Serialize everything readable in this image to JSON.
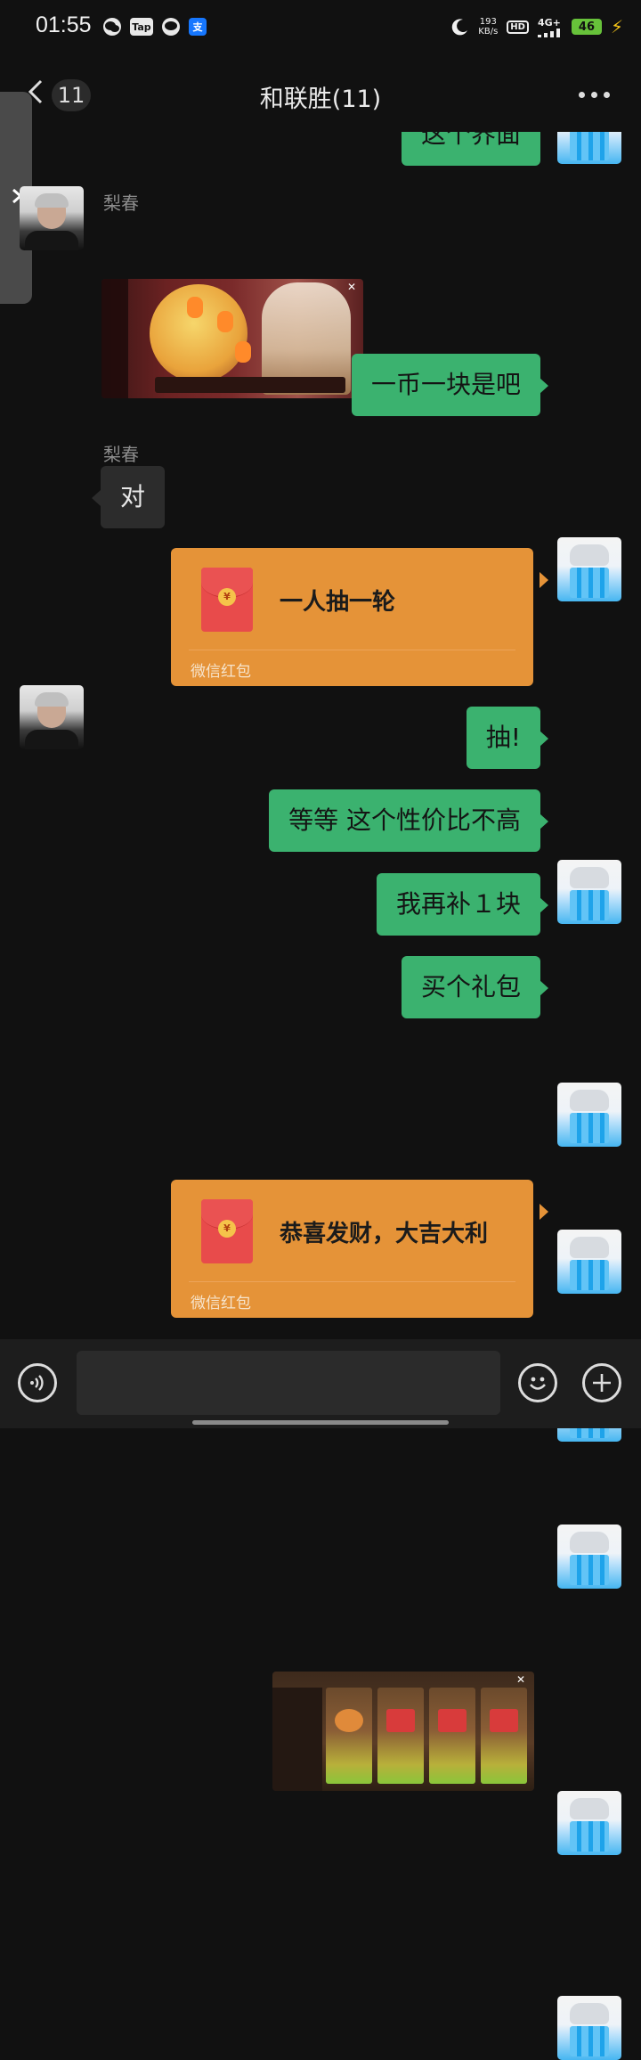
{
  "status_bar": {
    "time": "01:55",
    "left_icons": [
      "wechat-icon",
      "tap-icon",
      "message-icon",
      "alipay-icon"
    ],
    "tap_label": "Tap",
    "alipay_label": "支",
    "net_speed_value": "193",
    "net_speed_unit": "KB/s",
    "hd_label": "HD",
    "signal_label": "4G+",
    "battery": "46"
  },
  "header": {
    "back_count": "11",
    "title": "和联胜(11)"
  },
  "messages": [
    {
      "side": "right",
      "type": "text",
      "text": "这个界面",
      "partial": true
    },
    {
      "side": "left",
      "type": "image",
      "sender": "梨春",
      "image": "game-event-screenshot"
    },
    {
      "side": "right",
      "type": "text",
      "text": "一币一块是吧"
    },
    {
      "side": "left",
      "type": "text",
      "sender": "梨春",
      "text": "对"
    },
    {
      "side": "right",
      "type": "red_packet",
      "text": "一人抽一轮",
      "label": "微信红包"
    },
    {
      "side": "right",
      "type": "text",
      "text": "抽!"
    },
    {
      "side": "right",
      "type": "text",
      "text": "等等 这个性价比不高"
    },
    {
      "side": "right",
      "type": "text",
      "text": "我再补１块"
    },
    {
      "side": "right",
      "type": "text",
      "text": "买个礼包"
    },
    {
      "side": "right",
      "type": "image",
      "image": "game-shop-screenshot"
    },
    {
      "side": "right",
      "type": "red_packet",
      "text": "恭喜发财，大吉大利",
      "label": "微信红包"
    }
  ],
  "red_packet_coin": "¥",
  "colors": {
    "background": "#111111",
    "bubble_green": "#3bb26f",
    "bubble_gray": "#2c2c2c",
    "red_packet": "#e59338"
  }
}
